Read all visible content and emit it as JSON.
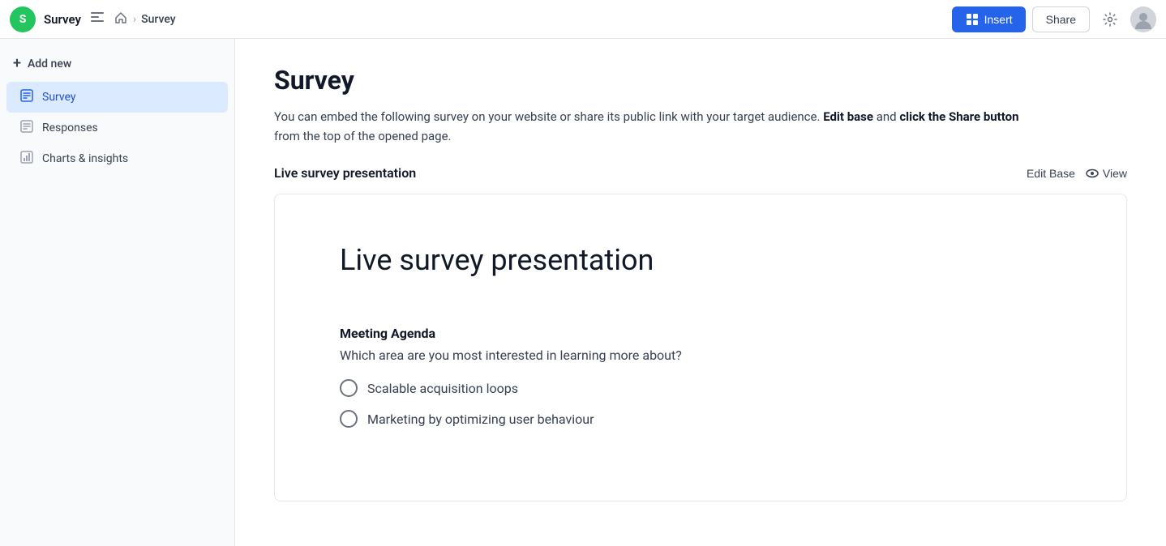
{
  "topnav": {
    "avatar_letter": "S",
    "app_title": "Survey",
    "breadcrumb_home": "🏠",
    "breadcrumb_sep": "›",
    "breadcrumb_current": "Survey",
    "insert_label": "Insert",
    "share_label": "Share"
  },
  "sidebar": {
    "add_new_label": "Add new",
    "items": [
      {
        "id": "survey",
        "label": "Survey",
        "active": true
      },
      {
        "id": "responses",
        "label": "Responses",
        "active": false
      },
      {
        "id": "charts",
        "label": "Charts & insights",
        "active": false
      }
    ]
  },
  "main": {
    "page_title": "Survey",
    "page_desc_1": "You can embed the following survey on your website or share its public link with your target audience.",
    "edit_base_inline": "Edit base",
    "and_text": "and",
    "click_share_inline": "click the Share button",
    "page_desc_2": "from the top of the opened page.",
    "section_title": "Live survey presentation",
    "edit_base_btn": "Edit Base",
    "view_btn": "View",
    "survey_card": {
      "title": "Live survey presentation",
      "question_section": "Meeting Agenda",
      "question_text": "Which area are you most interested in learning more about?",
      "options": [
        "Scalable acquisition loops",
        "Marketing by optimizing user behaviour"
      ]
    }
  }
}
